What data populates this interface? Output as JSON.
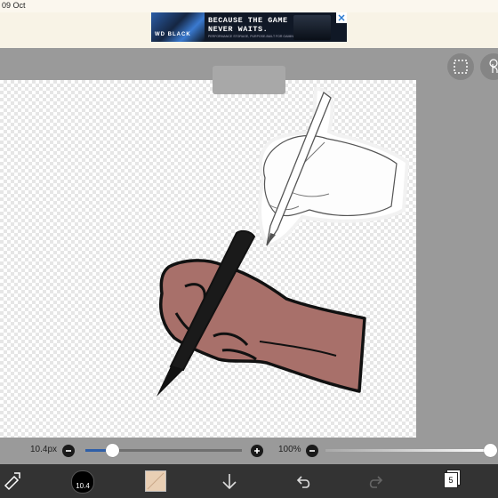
{
  "status_bar": {
    "time": "09 Oct"
  },
  "ad": {
    "headline": "BECAUSE THE GAME NEVER WAITS.",
    "subtext": "PERFORMANCE STORAGE, PURPOSE-BUILT FOR GAMING",
    "brand": "WD BLACK"
  },
  "toolbar": {
    "selection_icon": "selection-icon",
    "gesture_icon": "touch-icon"
  },
  "canvas": {
    "skin_color": "#a8706a",
    "pen_color": "#1a1a1a"
  },
  "brush_controls": {
    "size_label": "10.4px",
    "size_level": 0.17,
    "opacity_label": "100%",
    "opacity_level": 1.0
  },
  "bottom_toolbar": {
    "brush_size_badge": "10.4",
    "color_swatch": "#e9cfb4",
    "layer_count": "5"
  }
}
